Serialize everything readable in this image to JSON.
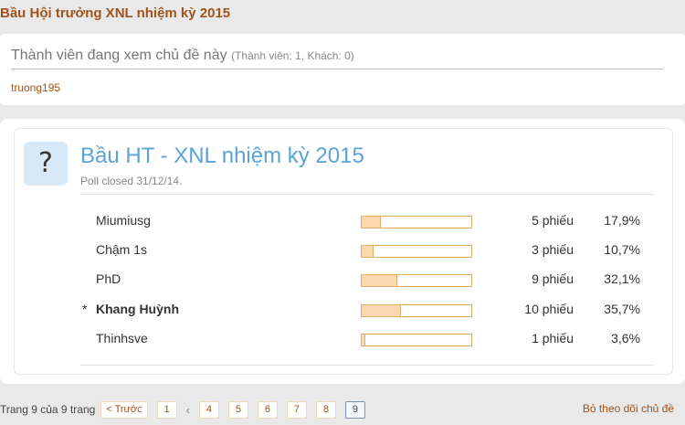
{
  "page": {
    "title": "Bầu Hội trưởng XNL nhiệm kỳ 2015"
  },
  "viewers": {
    "title": "Thành viên đang xem chủ đề này",
    "counts": "(Thành viên: 1, Khách: 0)",
    "user": "truong195"
  },
  "poll": {
    "icon": "question-icon",
    "title": "Bầu HT - XNL nhiệm kỳ 2015",
    "closed": "Poll closed 31/12/14.",
    "results": [
      {
        "marker": "",
        "name": "Miumiusg",
        "votes": "5 phiếu",
        "percent": "17,9%",
        "fraction": 0.179,
        "chosen": false
      },
      {
        "marker": "",
        "name": "Chậm 1s",
        "votes": "3 phiếu",
        "percent": "10,7%",
        "fraction": 0.107,
        "chosen": false
      },
      {
        "marker": "",
        "name": "PhD",
        "votes": "9 phiếu",
        "percent": "32,1%",
        "fraction": 0.321,
        "chosen": false
      },
      {
        "marker": "*",
        "name": "Khang Huỳnh",
        "votes": "10 phiếu",
        "percent": "35,7%",
        "fraction": 0.357,
        "chosen": true
      },
      {
        "marker": "",
        "name": "Thinhsve",
        "votes": "1 phiếu",
        "percent": "3,6%",
        "fraction": 0.036,
        "chosen": false
      }
    ]
  },
  "pagination": {
    "label": "Trang 9 của 9 trang",
    "prev": "< Trước",
    "first": "1",
    "gap": "‹",
    "pages": [
      "4",
      "5",
      "6",
      "7",
      "8",
      "9"
    ],
    "current": "9"
  },
  "actions": {
    "unwatch": "Bỏ theo dõi chủ đề"
  },
  "colors": {
    "accent": "#a2531a",
    "poll_title": "#5aa4d6",
    "bar_fill": "#fbd8ad",
    "bar_border": "#e3ab6a"
  }
}
